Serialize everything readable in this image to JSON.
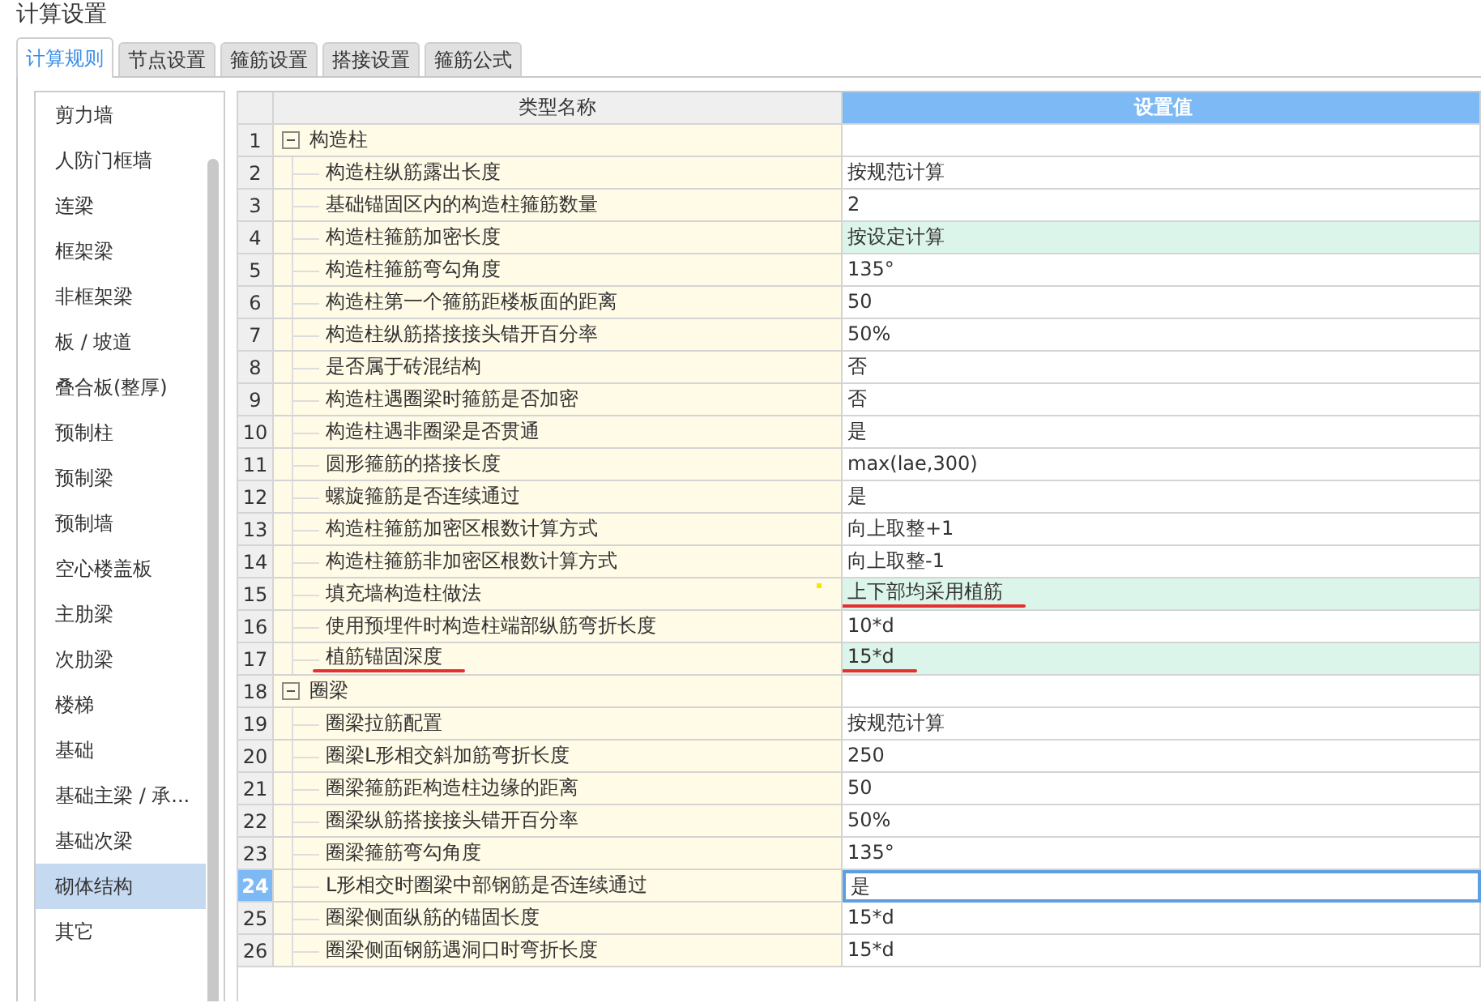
{
  "window": {
    "title": "计算设置"
  },
  "tabs": [
    {
      "label": "计算规则",
      "selected": true
    },
    {
      "label": "节点设置",
      "selected": false
    },
    {
      "label": "箍筋设置",
      "selected": false
    },
    {
      "label": "搭接设置",
      "selected": false
    },
    {
      "label": "箍筋公式",
      "selected": false
    }
  ],
  "sidebar": {
    "items": [
      {
        "label": "剪力墙",
        "selected": false
      },
      {
        "label": "人防门框墙",
        "selected": false
      },
      {
        "label": "连梁",
        "selected": false
      },
      {
        "label": "框架梁",
        "selected": false
      },
      {
        "label": "非框架梁",
        "selected": false
      },
      {
        "label": "板 / 坡道",
        "selected": false
      },
      {
        "label": "叠合板(整厚)",
        "selected": false
      },
      {
        "label": "预制柱",
        "selected": false
      },
      {
        "label": "预制梁",
        "selected": false
      },
      {
        "label": "预制墙",
        "selected": false
      },
      {
        "label": "空心楼盖板",
        "selected": false
      },
      {
        "label": "主肋梁",
        "selected": false
      },
      {
        "label": "次肋梁",
        "selected": false
      },
      {
        "label": "楼梯",
        "selected": false
      },
      {
        "label": "基础",
        "selected": false
      },
      {
        "label": "基础主梁 / 承...",
        "selected": false
      },
      {
        "label": "基础次梁",
        "selected": false
      },
      {
        "label": "砌体结构",
        "selected": true
      },
      {
        "label": "其它",
        "selected": false
      }
    ]
  },
  "table": {
    "columns": [
      "类型名称",
      "设置值"
    ],
    "rows": [
      {
        "kind": "group",
        "num": "1",
        "name": "构造柱",
        "expanded": true,
        "selected": false
      },
      {
        "kind": "item",
        "num": "2",
        "name": "构造柱纵筋露出长度",
        "value": "按规范计算",
        "changed": false,
        "selected": false
      },
      {
        "kind": "item",
        "num": "3",
        "name": "基础锚固区内的构造柱箍筋数量",
        "value": "2",
        "changed": false,
        "selected": false
      },
      {
        "kind": "item",
        "num": "4",
        "name": "构造柱箍筋加密长度",
        "value": "按设定计算",
        "changed": true,
        "selected": false
      },
      {
        "kind": "item",
        "num": "5",
        "name": "构造柱箍筋弯勾角度",
        "value": "135°",
        "changed": false,
        "selected": false
      },
      {
        "kind": "item",
        "num": "6",
        "name": "构造柱第一个箍筋距楼板面的距离",
        "value": "50",
        "changed": false,
        "selected": false
      },
      {
        "kind": "item",
        "num": "7",
        "name": "构造柱纵筋搭接接头错开百分率",
        "value": "50%",
        "changed": false,
        "selected": false
      },
      {
        "kind": "item",
        "num": "8",
        "name": "是否属于砖混结构",
        "value": "否",
        "changed": false,
        "selected": false
      },
      {
        "kind": "item",
        "num": "9",
        "name": "构造柱遇圈梁时箍筋是否加密",
        "value": "否",
        "changed": false,
        "selected": false
      },
      {
        "kind": "item",
        "num": "10",
        "name": "构造柱遇非圈梁是否贯通",
        "value": "是",
        "changed": false,
        "selected": false
      },
      {
        "kind": "item",
        "num": "11",
        "name": "圆形箍筋的搭接长度",
        "value": "max(lae,300)",
        "changed": false,
        "selected": false
      },
      {
        "kind": "item",
        "num": "12",
        "name": "螺旋箍筋是否连续通过",
        "value": "是",
        "changed": false,
        "selected": false
      },
      {
        "kind": "item",
        "num": "13",
        "name": "构造柱箍筋加密区根数计算方式",
        "value": "向上取整+1",
        "changed": false,
        "selected": false
      },
      {
        "kind": "item",
        "num": "14",
        "name": "构造柱箍筋非加密区根数计算方式",
        "value": "向上取整-1",
        "changed": false,
        "selected": false
      },
      {
        "kind": "item",
        "num": "15",
        "name": "填充墙构造柱做法",
        "value": "上下部均采用植筋",
        "changed": true,
        "selected": false,
        "flag": true,
        "value_underlined": true
      },
      {
        "kind": "item",
        "num": "16",
        "name": "使用预埋件时构造柱端部纵筋弯折长度",
        "value": "10*d",
        "changed": false,
        "selected": false
      },
      {
        "kind": "item",
        "num": "17",
        "name": "植筋锚固深度",
        "value": "15*d",
        "changed": true,
        "selected": false,
        "name_underlined": true,
        "value_underlined": true
      },
      {
        "kind": "group",
        "num": "18",
        "name": "圈梁",
        "expanded": true,
        "selected": false
      },
      {
        "kind": "item",
        "num": "19",
        "name": "圈梁拉筋配置",
        "value": "按规范计算",
        "changed": false,
        "selected": false
      },
      {
        "kind": "item",
        "num": "20",
        "name": "圈梁L形相交斜加筋弯折长度",
        "value": "250",
        "changed": false,
        "selected": false
      },
      {
        "kind": "item",
        "num": "21",
        "name": "圈梁箍筋距构造柱边缘的距离",
        "value": "50",
        "changed": false,
        "selected": false
      },
      {
        "kind": "item",
        "num": "22",
        "name": "圈梁纵筋搭接接头错开百分率",
        "value": "50%",
        "changed": false,
        "selected": false
      },
      {
        "kind": "item",
        "num": "23",
        "name": "圈梁箍筋弯勾角度",
        "value": "135°",
        "changed": false,
        "selected": false
      },
      {
        "kind": "item",
        "num": "24",
        "name": "L形相交时圈梁中部钢筋是否连续通过",
        "value": "是",
        "changed": false,
        "selected": true
      },
      {
        "kind": "item",
        "num": "25",
        "name": "圈梁侧面纵筋的锚固长度",
        "value": "15*d",
        "changed": false,
        "selected": false
      },
      {
        "kind": "item",
        "num": "26",
        "name": "圈梁侧面钢筋遇洞口时弯折长度",
        "value": "15*d",
        "changed": false,
        "selected": false
      }
    ]
  }
}
